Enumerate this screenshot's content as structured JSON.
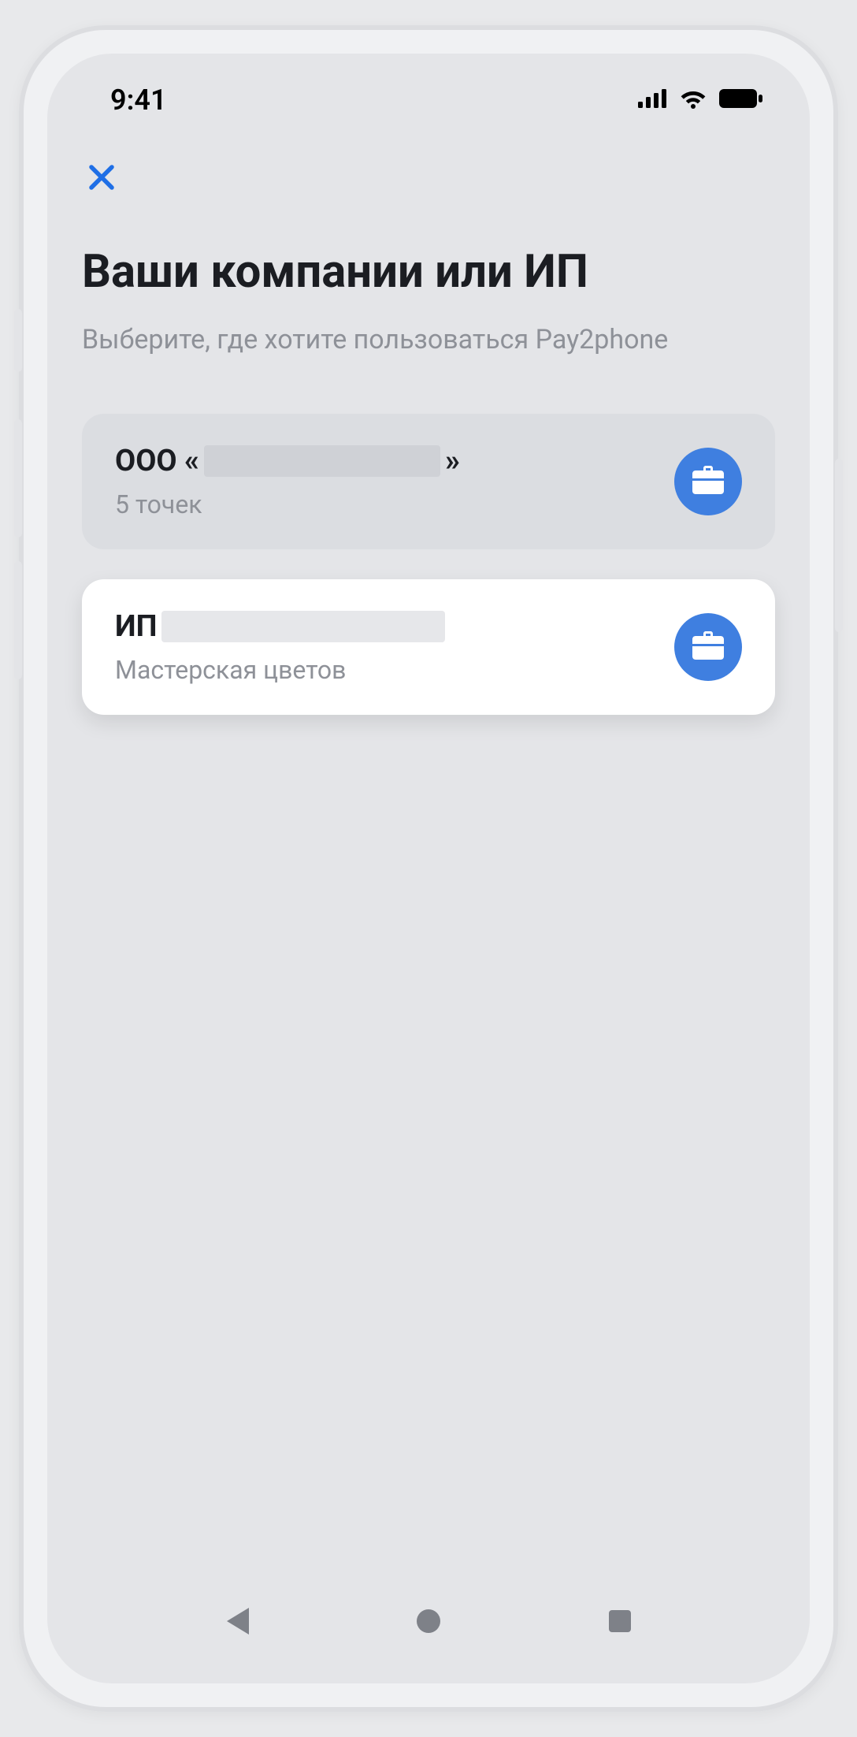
{
  "status": {
    "time": "9:41"
  },
  "header": {
    "title": "Ваши компании или ИП",
    "subtitle": "Выберите, где хотите пользоваться Pay2phone"
  },
  "companies": [
    {
      "prefix": "ООО «",
      "suffix": "»",
      "subtitle": "5 точек",
      "selected": false
    },
    {
      "prefix": "ИП",
      "suffix": "",
      "subtitle": "Мастерская цветов",
      "selected": true
    }
  ],
  "colors": {
    "accent": "#3f7fe0",
    "close": "#1f6fe6"
  }
}
